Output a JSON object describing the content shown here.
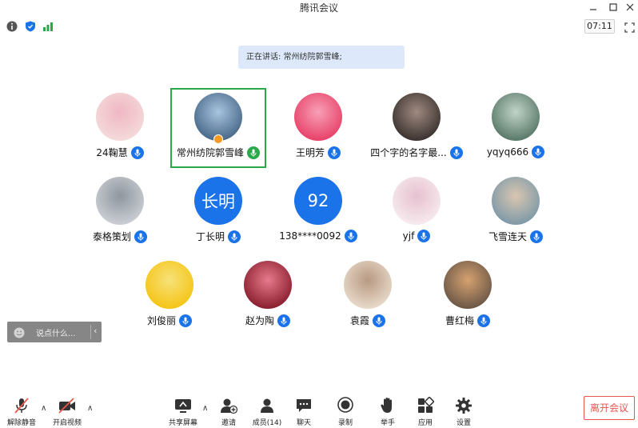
{
  "window": {
    "title": "腾讯会议"
  },
  "topbar": {
    "timer": "07:11"
  },
  "speaking": {
    "text": "正在讲话: 常州纺院郭雪峰;"
  },
  "participants": [
    {
      "name": "24鞠慧",
      "avatar": "photo",
      "mic": "on"
    },
    {
      "name": "常州纺院郭雪峰",
      "avatar": "photo",
      "mic": "speaking",
      "active": true,
      "host": true
    },
    {
      "name": "王明芳",
      "avatar": "photo",
      "mic": "on"
    },
    {
      "name": "四个字的名字最...",
      "avatar": "photo",
      "mic": "on"
    },
    {
      "name": "yqyq666",
      "avatar": "photo",
      "mic": "on"
    },
    {
      "name": "泰格策划",
      "avatar": "photo",
      "mic": "on"
    },
    {
      "name": "丁长明",
      "avatar_text": "长明",
      "mic": "on"
    },
    {
      "name": "138****0092",
      "avatar_text": "92",
      "mic": "on"
    },
    {
      "name": "yjf",
      "avatar": "photo",
      "mic": "on"
    },
    {
      "name": "飞雪连天",
      "avatar": "photo",
      "mic": "on"
    },
    {
      "name": "刘俊丽",
      "avatar": "photo",
      "mic": "on"
    },
    {
      "name": "赵为陶",
      "avatar": "photo",
      "mic": "on"
    },
    {
      "name": "袁霞",
      "avatar": "photo",
      "mic": "on"
    },
    {
      "name": "曹红梅",
      "avatar": "photo",
      "mic": "on"
    }
  ],
  "chat": {
    "placeholder": "说点什么..."
  },
  "toolbar": {
    "unmute": "解除静音",
    "video": "开启视频",
    "share": "共享屏幕",
    "invite": "邀请",
    "members": "成员(14)",
    "chat": "聊天",
    "record": "录制",
    "raise_hand": "举手",
    "apps": "应用",
    "settings": "设置",
    "leave": "离开会议"
  },
  "colors": {
    "accent": "#1a73e8",
    "speaking": "#2aa84a",
    "leave": "#e9564d",
    "banner": "#dde9fb"
  }
}
